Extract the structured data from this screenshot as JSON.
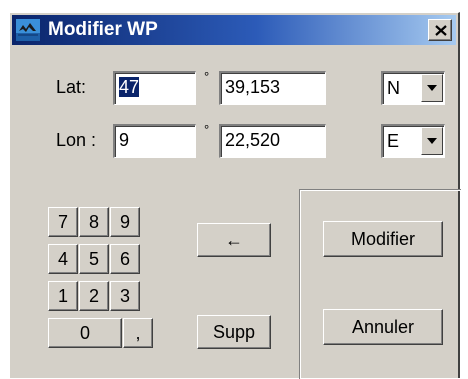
{
  "window": {
    "title": "Modifier WP",
    "close_glyph": "✕"
  },
  "latitude": {
    "label": "Lat:",
    "degrees": "47",
    "degree_symbol": "°",
    "minutes": "39,153",
    "hemisphere": "N"
  },
  "longitude": {
    "label": "Lon :",
    "degrees": "9",
    "degree_symbol": "°",
    "minutes": "22,520",
    "hemisphere": "E"
  },
  "keypad": {
    "keys": [
      "7",
      "8",
      "9",
      "4",
      "5",
      "6",
      "1",
      "2",
      "3",
      "0",
      ","
    ]
  },
  "buttons": {
    "backspace": "←",
    "delete": "Supp",
    "modify": "Modifier",
    "cancel": "Annuler"
  },
  "icons": {
    "app": "waypoint-app-icon",
    "close": "close-icon",
    "dropdown": "dropdown-arrow-icon"
  },
  "colors": {
    "titlebar_start": "#0a246a",
    "titlebar_end": "#a6caf0",
    "face": "#d4d0c8",
    "selection": "#0a246a"
  }
}
